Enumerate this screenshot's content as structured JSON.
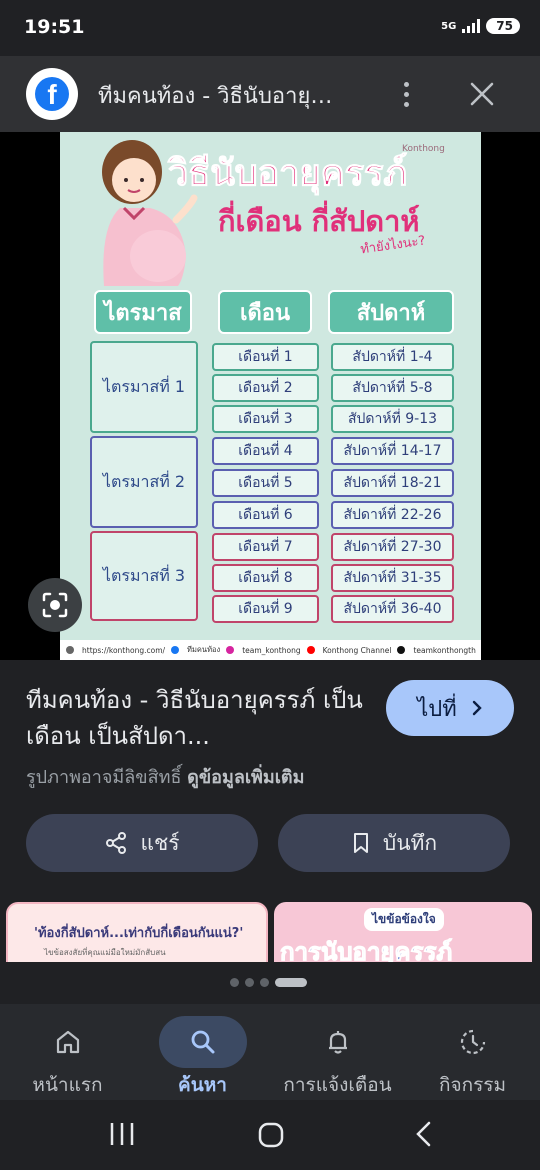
{
  "status_bar": {
    "time": "19:51",
    "network": "5G",
    "battery": "75"
  },
  "header": {
    "source_icon": "facebook-icon",
    "title": "ทีมคนท้อง - วิธีนับอายุ…"
  },
  "poster": {
    "title_line1": "วิธีนับอายุครรภ์",
    "title_line2": "กี่เดือน กี่สัปดาห์",
    "subtitle": "ทำยังไงนะ?",
    "logo_text": "Konthong",
    "col_headers": [
      "ไตรมาส",
      "เดือน",
      "สัปดาห์"
    ],
    "trimesters": [
      {
        "label": "ไตรมาสที่ 1",
        "color": "#4aa88e"
      },
      {
        "label": "ไตรมาสที่ 2",
        "color": "#5a5fb0"
      },
      {
        "label": "ไตรมาสที่ 3",
        "color": "#c0446a"
      }
    ],
    "months": [
      "เดือนที่ 1",
      "เดือนที่ 2",
      "เดือนที่ 3",
      "เดือนที่ 4",
      "เดือนที่ 5",
      "เดือนที่ 6",
      "เดือนที่ 7",
      "เดือนที่ 8",
      "เดือนที่ 9"
    ],
    "weeks": [
      "สัปดาห์ที่ 1-4",
      "สัปดาห์ที่ 5-8",
      "สัปดาห์ที่ 9-13",
      "สัปดาห์ที่ 14-17",
      "สัปดาห์ที่ 18-21",
      "สัปดาห์ที่ 22-26",
      "สัปดาห์ที่ 27-30",
      "สัปดาห์ที่ 31-35",
      "สัปดาห์ที่ 36-40"
    ],
    "footer": {
      "website": "https://konthong.com/",
      "facebook": "ทีมคนท้อง",
      "instagram": "team_konthong",
      "youtube": "Konthong Channel",
      "tiktok": "teamkonthongth"
    }
  },
  "info": {
    "title": "ทีมคนท้อง - วิธีนับอายุครรภ์ เป็นเดือน เป็นสัปดา...",
    "goto_label": "ไปที่",
    "copyright_text": "รูปภาพอาจมีลิขสิทธิ์",
    "more_info_link": "ดูข้อมูลเพิ่มเติม",
    "share_label": "แชร์",
    "save_label": "บันทึก"
  },
  "related": [
    {
      "title": "'ท้องกี่สัปดาห์...เท่ากับกี่เดือนกันแน่?'",
      "subtitle": "ไขข้อสงสัยที่คุณแม่มือใหม่มักสับสน"
    },
    {
      "title": "ไขข้อข้องใจ",
      "subtitle": "การนับอายุครรภ์"
    }
  ],
  "bottom_nav": [
    {
      "label": "หน้าแรก",
      "icon": "home-icon"
    },
    {
      "label": "ค้นหา",
      "icon": "search-icon",
      "active": true
    },
    {
      "label": "การแจ้งเตือน",
      "icon": "bell-icon"
    },
    {
      "label": "กิจกรรม",
      "icon": "activity-icon"
    }
  ],
  "system_nav": {
    "icons": [
      "recents-icon",
      "home-circle-icon",
      "back-icon"
    ]
  }
}
